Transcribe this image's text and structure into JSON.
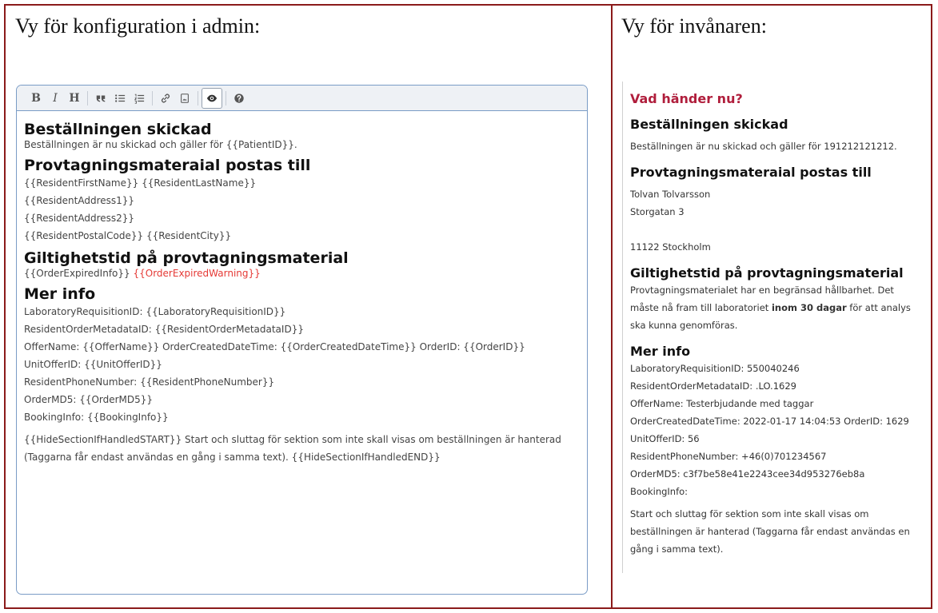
{
  "left_heading": "Vy för konfiguration i admin:",
  "right_heading": "Vy för invånaren:",
  "toolbar": {
    "bold": "B",
    "italic": "I",
    "heading": "H",
    "icons": [
      "quote-icon",
      "bullet-list-icon",
      "numbered-list-icon",
      "link-icon",
      "image-icon",
      "preview-eye-icon",
      "help-icon"
    ]
  },
  "editor": {
    "h1": "Beställningen skickad",
    "p1": "Beställningen är nu skickad och gäller för {{PatientID}}.",
    "h2": "Provtagningsmateraial postas till",
    "addr": [
      "{{ResidentFirstName}} {{ResidentLastName}}",
      "{{ResidentAddress1}}",
      "{{ResidentAddress2}}",
      "{{ResidentPostalCode}} {{ResidentCity}}"
    ],
    "h3": "Giltighetstid på provtagningsmaterial",
    "expired_info": "{{OrderExpiredInfo}}",
    "expired_warning": "{{OrderExpiredWarning}}",
    "h4": "Mer info",
    "info": [
      "LaboratoryRequisitionID: {{LaboratoryRequisitionID}}",
      "ResidentOrderMetadataID: {{ResidentOrderMetadataID}}",
      "OfferName: {{OfferName}} OrderCreatedDateTime: {{OrderCreatedDateTime}} OrderID: {{OrderID}}",
      "UnitOfferID: {{UnitOfferID}}",
      "ResidentPhoneNumber: {{ResidentPhoneNumber}}",
      "OrderMD5: {{OrderMD5}}",
      "BookingInfo: {{BookingInfo}}"
    ],
    "hide_line1": "{{HideSectionIfHandledSTART}} Start och sluttag för sektion som inte skall visas om beställningen är hanterad",
    "hide_line2": "(Taggarna får endast användas en gång i samma text). {{HideSectionIfHandledEND}}"
  },
  "preview": {
    "title": "Vad händer nu?",
    "h1": "Beställningen skickad",
    "p1": "Beställningen är nu skickad och gäller för 191212121212.",
    "h2": "Provtagningsmateraial postas till",
    "addr1": "Tolvan Tolvarsson",
    "addr2": "Storgatan 3",
    "addr3": "11122 Stockholm",
    "h3": "Giltighetstid på provtagningsmaterial",
    "valid_1": "Provtagningsmaterialet har en begränsad hållbarhet. Det",
    "valid_2a": "måste nå fram till laboratoriet ",
    "valid_2b": "inom 30 dagar",
    "valid_2c": " för att analys",
    "valid_3": "ska kunna genomföras.",
    "h4": "Mer info",
    "info": [
      "LaboratoryRequisitionID: 550040246",
      "ResidentOrderMetadataID: .LO.1629",
      "OfferName: Testerbjudande med taggar",
      "OrderCreatedDateTime: 2022-01-17 14:04:53 OrderID: 1629",
      "UnitOfferID: 56",
      "ResidentPhoneNumber: +46(0)701234567",
      "OrderMD5: c3f7be58e41e2243cee34d953276eb8a",
      "BookingInfo:"
    ],
    "hide": [
      "Start och sluttag för sektion som inte skall visas om",
      "beställningen är hanterad (Taggarna får endast användas en",
      "gång i samma text)."
    ]
  }
}
